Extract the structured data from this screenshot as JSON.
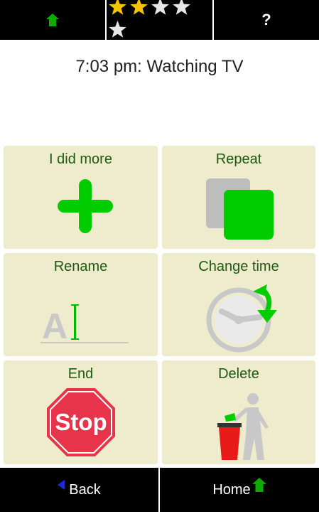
{
  "header": {
    "home_icon": "home-arrow-icon",
    "rating": {
      "value": 2,
      "max": 5,
      "filled_color": "#f5c400",
      "empty_color": "#e6e6e6"
    },
    "help_label": "?"
  },
  "status": {
    "text": "7:03 pm: Watching TV"
  },
  "actions": {
    "did_more": {
      "label": "I did more",
      "icon": "plus-icon"
    },
    "repeat": {
      "label": "Repeat",
      "icon": "copy-squares-icon"
    },
    "rename": {
      "label": "Rename",
      "icon": "text-cursor-icon",
      "glyph": "A"
    },
    "change_time": {
      "label": "Change time",
      "icon": "clock-arrow-icon"
    },
    "end": {
      "label": "End",
      "icon": "stop-sign-icon",
      "sign_text": "Stop"
    },
    "delete": {
      "label": "Delete",
      "icon": "trash-bin-icon"
    }
  },
  "footer": {
    "back_label": "Back",
    "home_label": "Home"
  },
  "colors": {
    "tile_bg": "#eeeccc",
    "label": "#1e5a12",
    "accent_green": "#00cc00",
    "stop_red": "#e8344a"
  }
}
